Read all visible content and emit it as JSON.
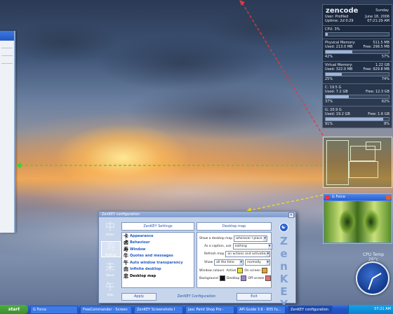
{
  "sysinfo": {
    "hostname": "zencode",
    "day": "Sunday",
    "user": "User: Profiled",
    "date": "June 18, 2006",
    "uptime": "Uptime: 2d 0:29",
    "time": "07:21:29 AM",
    "cpu_label": "CPU:",
    "cpu_value": "3%",
    "cpu_fill": 0.03,
    "phys_label": "Physical Memory:",
    "phys_total": "511.5 MB",
    "phys_used": "Used: 213.0 MB",
    "phys_free": "Free: 298.5 MB",
    "phys_used_pct": "42%",
    "phys_free_pct": "57%",
    "phys_fill": 0.42,
    "virt_label": "Virtual Memory:",
    "virt_total": "1.22 GB",
    "virt_used": "Used: 322.0 MB",
    "virt_free": "Free: 929.8 MB",
    "virt_used_pct": "25%",
    "virt_free_pct": "74%",
    "virt_fill": 0.25,
    "c_label": "C: 19.5 G",
    "c_used": "Used: 7.2 GB",
    "c_free": "Free: 12.3 GB",
    "c_used_pct": "37%",
    "c_free_pct": "62%",
    "c_fill": 0.37,
    "g_label": "G: 20.9 G",
    "g_used": "Used: 19.2 GB",
    "g_free": "Free: 1.6 GB",
    "g_used_pct": "91%",
    "g_free_pct": "8%",
    "g_fill": 0.91
  },
  "preview": {
    "title": "G Force"
  },
  "cpu_temp": {
    "label": "CPU Temp",
    "value": "26°c"
  },
  "zenkey": {
    "title": "ZenKEY configuration",
    "settings_header": "ZenKEY Settings",
    "panel_header": "Desktop map",
    "sidebar": [
      {
        "glyph": "中",
        "label": "Home"
      },
      {
        "glyph": "寿",
        "label": "Settings"
      },
      {
        "glyph": "未",
        "label": "About"
      },
      {
        "glyph": "午",
        "label": "Help"
      }
    ],
    "menu": [
      {
        "glyph": "卡",
        "label": "Appearance"
      },
      {
        "glyph": "卤",
        "label": "Behaviour"
      },
      {
        "glyph": "寿",
        "label": "Window"
      },
      {
        "glyph": "牛",
        "label": "Quotes and messages"
      },
      {
        "glyph": "午",
        "label": "Auto window transparency"
      },
      {
        "glyph": "由",
        "label": "Infinite desktop"
      },
      {
        "glyph": "忠",
        "label": "Desktop map"
      }
    ],
    "options": {
      "show_label": "Show a desktop map",
      "show_value": "wherever I place it",
      "caption_label": "As a caption, use",
      "caption_value": "nothing",
      "refresh_label": "Refresh map",
      "refresh_value": "on actions and activations",
      "show2_label": "Show",
      "show2_value": "all the time",
      "show3_value": "normally",
      "colours_label": "Window colours",
      "active_label": "Active",
      "on_screen": "On screen",
      "background_label": "Background",
      "desktop_label": "Desktop",
      "off_screen": "Off screen"
    },
    "apply": "Apply",
    "footer": "ZenKEY Configuration",
    "exit": "Exit",
    "logo": "ZenKEY",
    "colors": {
      "active": "#f0e020",
      "on_screen": "#f0a020",
      "background": "#111111",
      "desktop": "#9a84c8",
      "off_screen": "#e07070"
    }
  },
  "taskbar": {
    "start": "start",
    "tasks": [
      "G Force",
      "FreeCommander - Screen",
      "ZenKEY Screenshots I",
      "Jasc Paint Shop Pro -",
      "API Guide 3.6 - 835 fu...",
      "ZenKEY configuration"
    ],
    "clock": "07:21 AM"
  }
}
